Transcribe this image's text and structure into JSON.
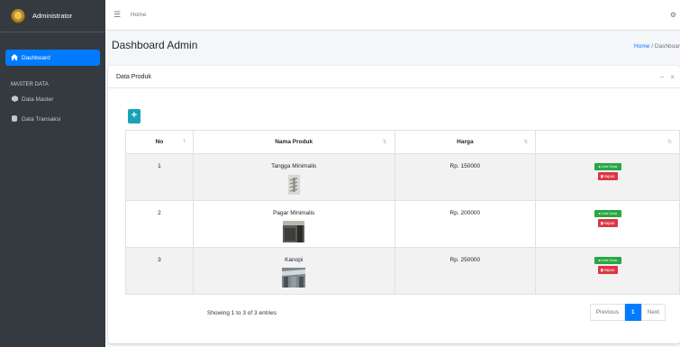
{
  "sidebar": {
    "brand": "Administrator",
    "active_item": "Dashboard",
    "section_header": "MASTER DATA",
    "items": [
      {
        "label": "Data Master",
        "icon": "cube-icon"
      },
      {
        "label": "Data Transaksi",
        "icon": "database-icon"
      }
    ]
  },
  "topbar": {
    "home_link": "Home"
  },
  "header": {
    "title": "Dashboard Admin",
    "breadcrumb_home": "Home",
    "breadcrumb_sep": "/",
    "breadcrumb_current": "Dashboar"
  },
  "card": {
    "title": "Data Produk",
    "add_label": "+",
    "collapse": "−",
    "close": "×"
  },
  "table": {
    "columns": [
      "No",
      "Nama Produk",
      "Harga",
      ""
    ],
    "rows": [
      {
        "no": "1",
        "name": "Tangga Minimalis",
        "price": "Rp. 150000",
        "view": "Lihat Data",
        "delete": "Hapus"
      },
      {
        "no": "2",
        "name": "Pagar Minimalis",
        "price": "Rp. 200000",
        "view": "Lihat Data",
        "delete": "Hapus"
      },
      {
        "no": "3",
        "name": "Kanopi",
        "price": "Rp. 250000",
        "view": "Lihat Data",
        "delete": "Hapus"
      }
    ]
  },
  "footer": {
    "showing": "Showing 1 to 3 of 3 entries",
    "previous": "Previous",
    "page": "1",
    "next": "Next"
  },
  "colors": {
    "sidebar": "#343a40",
    "primary": "#007bff",
    "info": "#17a2b8",
    "success": "#28a745",
    "danger": "#dc3545"
  }
}
